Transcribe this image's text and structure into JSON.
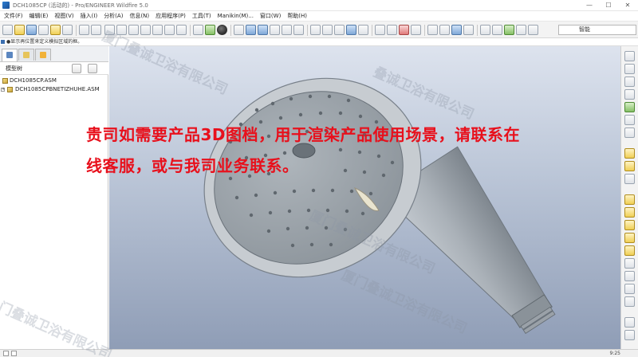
{
  "window": {
    "title": "DCH1085CP (活动的) - Pro/ENGINEER Wildfire 5.0",
    "minimize": "—",
    "maximize": "☐",
    "close": "✕"
  },
  "menubar": {
    "items": [
      "文件(F)",
      "编辑(E)",
      "视图(V)",
      "插入(I)",
      "分析(A)",
      "信息(N)",
      "应用程序(P)",
      "工具(T)",
      "Manikin(M)...",
      "窗口(W)",
      "帮助(H)"
    ]
  },
  "toolbar": {
    "smart_filter_label": "智能"
  },
  "hint": {
    "text": "●显示再位置来定义模拟区域的框。"
  },
  "navigator": {
    "tree_title": "模型树",
    "tree_items": [
      {
        "label": "DCH1085CP.ASM",
        "expandable": false
      },
      {
        "label": "DCH1085CPBNETIZHUHE.ASM",
        "expandable": true
      }
    ]
  },
  "overlay": {
    "line1": "贵司如需要产品3D图档，用于渲染产品使用场景，请联系在",
    "line2": "线客服，或与我司业务联系。",
    "color": "#e8101c"
  },
  "watermarks": [
    "厦门叠诚卫浴有限公司",
    "叠诚卫浴有限公司",
    "厦门叠诚卫浴有限公司",
    "厦门叠诚卫浴有限公司",
    "门叠诚卫浴有限公司"
  ],
  "statusbar": {
    "time": "9:25"
  },
  "colors": {
    "viewport_top": "#dde3ee",
    "viewport_bottom": "#8f9db6",
    "model": "#a9b0b6"
  }
}
